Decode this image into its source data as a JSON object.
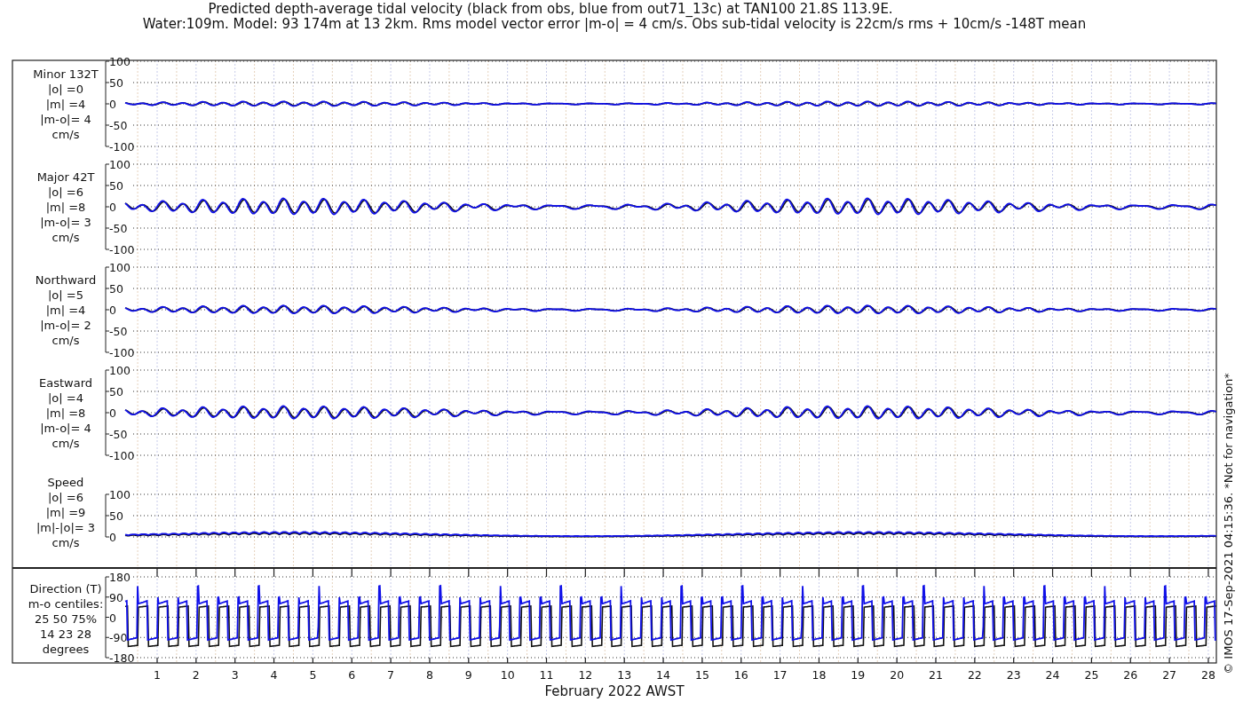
{
  "title_lines": [
    "Predicted depth-average tidal velocity (black from obs, blue from out71_13c) at TAN100 21.8S 113.9E.",
    "Water:109m. Model: 93 174m at 13 2km. Rms model vector error |m-o| = 4 cm/s. Obs sub-tidal velocity is 22cm/s rms + 10cm/s -148T mean"
  ],
  "panels": [
    {
      "kind": "velocity",
      "label_lines": [
        "Minor 132T",
        "|o| =0",
        "|m| =4",
        "|m-o|= 4",
        "cm/s"
      ],
      "y_ticks": [
        "100",
        "50",
        "0",
        "-50",
        "-100"
      ]
    },
    {
      "kind": "velocity",
      "label_lines": [
        "Major 42T",
        "|o| =6",
        "|m| =8",
        "|m-o|= 3",
        "cm/s"
      ],
      "y_ticks": [
        "100",
        "50",
        "0",
        "-50",
        "-100"
      ]
    },
    {
      "kind": "velocity",
      "label_lines": [
        "Northward",
        "|o| =5",
        "|m| =4",
        "|m-o|= 2",
        "cm/s"
      ],
      "y_ticks": [
        "100",
        "50",
        "0",
        "-50",
        "-100"
      ]
    },
    {
      "kind": "velocity",
      "label_lines": [
        "Eastward",
        "|o| =4",
        "|m| =8",
        "|m-o|= 4",
        "cm/s"
      ],
      "y_ticks": [
        "100",
        "50",
        "0",
        "-50",
        "-100"
      ]
    },
    {
      "kind": "speed",
      "label_lines": [
        "Speed",
        "|o| =6",
        "|m| =9",
        "|m|-|o|= 3",
        "cm/s"
      ],
      "y_ticks": [
        "100",
        "50",
        "0"
      ]
    },
    {
      "kind": "direction",
      "label_lines": [
        "Direction (T)",
        "m-o centiles:",
        "25  50  75%",
        "14  23  28",
        "degrees"
      ],
      "y_ticks": [
        "180",
        "90",
        "0",
        "-90",
        "-180"
      ]
    }
  ],
  "x_ticks": [
    "1",
    "2",
    "3",
    "4",
    "5",
    "6",
    "7",
    "8",
    "9",
    "10",
    "11",
    "12",
    "13",
    "14",
    "15",
    "16",
    "17",
    "18",
    "19",
    "20",
    "21",
    "22",
    "23",
    "24",
    "25",
    "26",
    "27",
    "28"
  ],
  "xlabel": "February 2022 AWST",
  "footer": "© IMOS 17-Sep-2021 04:15:36. *Not for navigation*"
}
